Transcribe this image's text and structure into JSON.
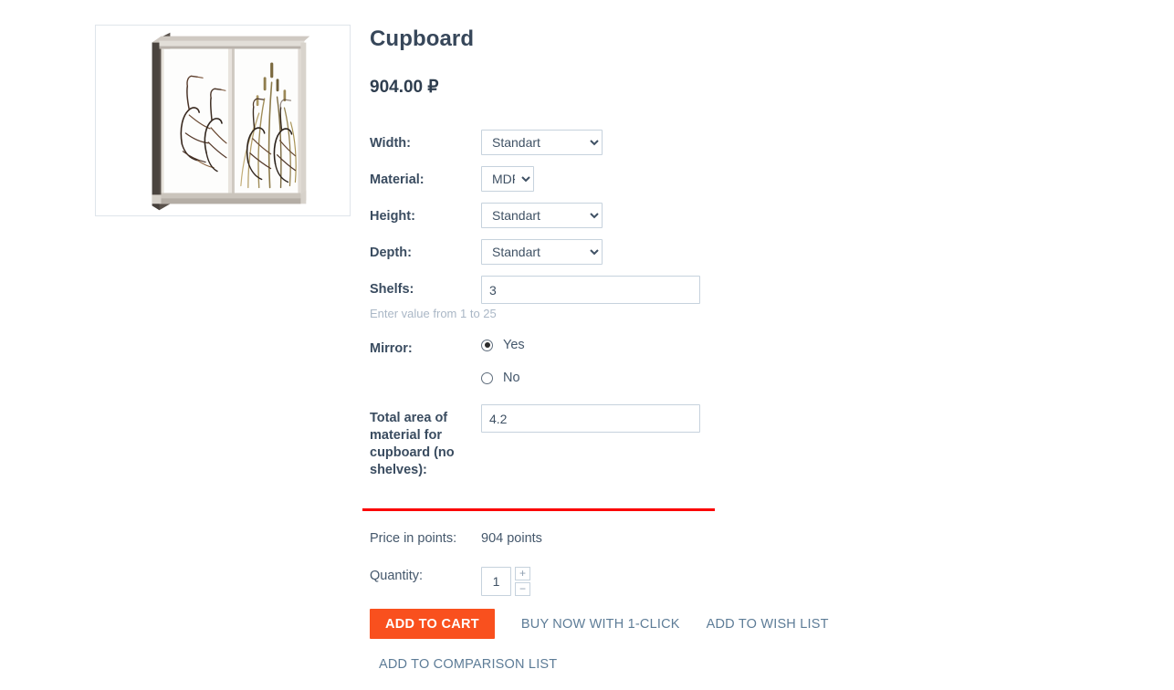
{
  "product": {
    "title": "Cupboard",
    "price": "904.00 ₽",
    "image_alt": "cupboard-sliding-door-wardrobe-with-cranes-and-reeds-artwork"
  },
  "options": [
    {
      "label": "Width:",
      "type": "select",
      "value": "Standart",
      "options": [
        "Standart"
      ],
      "name": "width"
    },
    {
      "label": "Material:",
      "type": "select",
      "value": "MDF",
      "options": [
        "MDF"
      ],
      "name": "material"
    },
    {
      "label": "Height:",
      "type": "select",
      "value": "Standart",
      "options": [
        "Standart"
      ],
      "name": "height"
    },
    {
      "label": "Depth:",
      "type": "select",
      "value": "Standart",
      "options": [
        "Standart"
      ],
      "name": "depth"
    },
    {
      "label": "Shelfs:",
      "type": "text",
      "value": "3",
      "hint": "Enter value from 1 to 25",
      "name": "shelfs"
    },
    {
      "label": "Mirror:",
      "type": "radio",
      "value": "Yes",
      "choices": [
        "Yes",
        "No"
      ],
      "name": "mirror"
    },
    {
      "label": "Total area of material for cupboard (no shelves):",
      "type": "text",
      "value": "4.2",
      "name": "total-area"
    }
  ],
  "points": {
    "label": "Price in points:",
    "value": "904 points"
  },
  "quantity": {
    "label": "Quantity:",
    "value": "1",
    "increase_label": "+",
    "decrease_label": "−"
  },
  "actions": {
    "add_to_cart": "ADD TO CART",
    "buy_now": "BUY NOW WITH 1-CLICK",
    "wish_list": "ADD TO WISH LIST",
    "comparison_list": "ADD TO COMPARISON LIST"
  },
  "colors": {
    "accent_orange": "#f9501e",
    "divider_red": "#fb0000",
    "link_blue": "#5d7c97",
    "label_dark": "#3a4c60",
    "hint_gray": "#aab7c6",
    "border_gray": "#c6d2dd"
  }
}
